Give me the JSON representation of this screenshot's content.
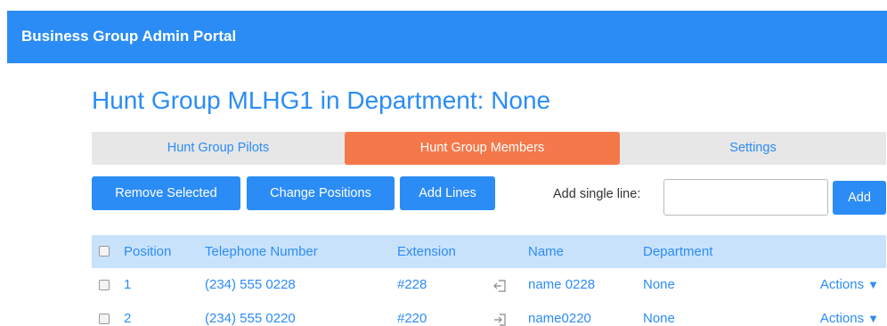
{
  "header": {
    "title": "Business Group Admin Portal"
  },
  "page": {
    "title": "Hunt Group MLHG1 in Department: None"
  },
  "tabs": [
    {
      "label": "Hunt Group Pilots"
    },
    {
      "label": "Hunt Group Members",
      "active": true
    },
    {
      "label": "Settings"
    }
  ],
  "toolbar": {
    "remove_label": "Remove Selected",
    "change_positions_label": "Change Positions",
    "add_lines_label": "Add Lines",
    "single_line_label": "Add single line:",
    "single_line_value": "",
    "add_label": "Add"
  },
  "table": {
    "headers": {
      "position": "Position",
      "telephone": "Telephone Number",
      "extension": "Extension",
      "name": "Name",
      "department": "Department"
    },
    "rows": [
      {
        "position": "1",
        "telephone": "(234) 555 0228",
        "extension": "#228",
        "icon": "sign-out-icon",
        "name": "name 0228",
        "department": "None",
        "actions": "Actions"
      },
      {
        "position": "2",
        "telephone": "(234) 555 0220",
        "extension": "#220",
        "icon": "sign-in-icon",
        "name": "name0220",
        "department": "None",
        "actions": "Actions"
      }
    ]
  },
  "colors": {
    "brand": "#2b8cf6",
    "active_tab": "#f5784a",
    "table_header": "#c9e2fb"
  }
}
